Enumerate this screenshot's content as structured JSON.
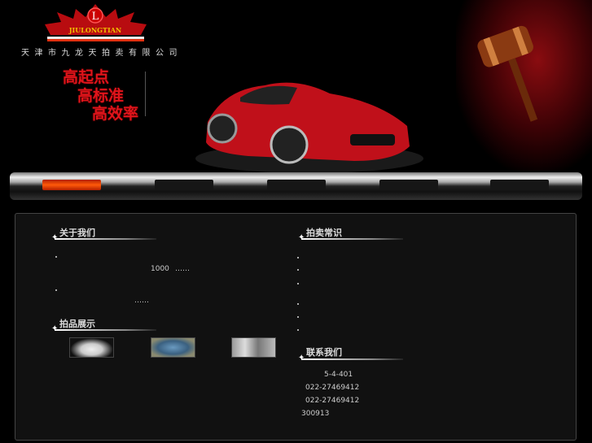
{
  "header": {
    "logo_text": "JIULONGTIAN",
    "company": "天津市九龙天拍卖有限公司",
    "slogans": [
      "高起点",
      "高标准",
      "高效率"
    ]
  },
  "nav": {
    "active_index": 0,
    "tab_count": 5
  },
  "about": {
    "title": "关于我们",
    "line1_num": "1000",
    "line1_ellipsis": "……",
    "line2_ellipsis": "……"
  },
  "showcase": {
    "title": "拍品展示",
    "items": [
      "jade-seal",
      "blue-bowl",
      "bronze-vessel"
    ]
  },
  "knowledge": {
    "title": "拍卖常识"
  },
  "contact": {
    "title": "联系我们",
    "address": "5-4-401",
    "phone": "022-27469412",
    "fax": "022-27469412",
    "postcode": "300913"
  }
}
